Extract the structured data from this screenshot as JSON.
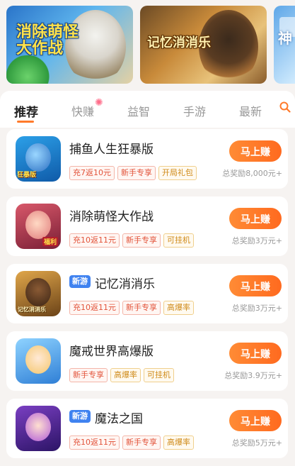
{
  "banners": [
    {
      "title": "消除萌怪大作战"
    },
    {
      "title": "记忆消消乐"
    },
    {
      "title": "神"
    }
  ],
  "tabs": [
    {
      "label": "推荐",
      "active": true
    },
    {
      "label": "快赚",
      "active": false
    },
    {
      "label": "益智",
      "active": false
    },
    {
      "label": "手游",
      "active": false
    },
    {
      "label": "最新",
      "active": false
    }
  ],
  "search": {
    "icon": "search-icon"
  },
  "games": [
    {
      "name": "捕鱼人生狂暴版",
      "new": false,
      "icon_label": "狂暴版",
      "tags": [
        {
          "text": "充7返10元",
          "style": "red"
        },
        {
          "text": "新手专享",
          "style": "red"
        },
        {
          "text": "开局礼包",
          "style": "gold"
        }
      ],
      "button": "马上赚",
      "reward_prefix": "总奖励",
      "reward_amount": "8,000元+"
    },
    {
      "name": "消除萌怪大作战",
      "new": false,
      "icon_label": "福利",
      "tags": [
        {
          "text": "充10返11元",
          "style": "red"
        },
        {
          "text": "新手专享",
          "style": "red"
        },
        {
          "text": "可挂机",
          "style": "gold"
        }
      ],
      "button": "马上赚",
      "reward_prefix": "总奖励",
      "reward_amount": "3万元+"
    },
    {
      "name": "记忆消消乐",
      "new": true,
      "new_label": "新游",
      "icon_label": "记忆消消乐",
      "tags": [
        {
          "text": "充10返11元",
          "style": "red"
        },
        {
          "text": "新手专享",
          "style": "red"
        },
        {
          "text": "高爆率",
          "style": "gold"
        }
      ],
      "button": "马上赚",
      "reward_prefix": "总奖励",
      "reward_amount": "3万元+"
    },
    {
      "name": "魔戒世界高爆版",
      "new": false,
      "icon_label": "",
      "tags": [
        {
          "text": "新手专享",
          "style": "red"
        },
        {
          "text": "高爆率",
          "style": "gold"
        },
        {
          "text": "可挂机",
          "style": "gold"
        }
      ],
      "button": "马上赚",
      "reward_prefix": "总奖励",
      "reward_amount": "3.9万元+"
    },
    {
      "name": "魔法之国",
      "new": true,
      "new_label": "新游",
      "icon_label": "",
      "tags": [
        {
          "text": "充10返11元",
          "style": "red"
        },
        {
          "text": "新手专享",
          "style": "red"
        },
        {
          "text": "高爆率",
          "style": "gold"
        }
      ],
      "button": "马上赚",
      "reward_prefix": "总奖励",
      "reward_amount": "5万元+"
    }
  ],
  "colors": {
    "accent": "#ff7a2a",
    "tag_red": "#e2533a",
    "tag_gold": "#cf8a18",
    "new_badge": "#3f82f0"
  }
}
